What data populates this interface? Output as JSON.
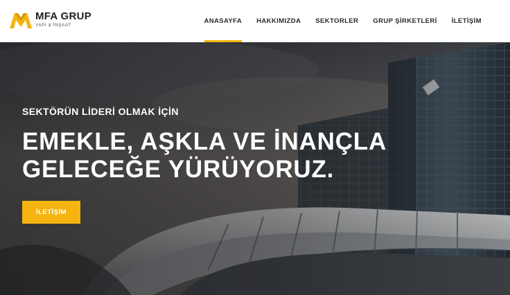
{
  "brand": {
    "name": "MFA GRUP",
    "tagline": "YAPI & İNŞAAT",
    "accent_color": "#f5b40f",
    "logo_icon": "m-shape-icon"
  },
  "nav": {
    "items": [
      {
        "label": "ANASAYFA",
        "active": true
      },
      {
        "label": "HAKKIMIZDA",
        "active": false
      },
      {
        "label": "SEKTORLER",
        "active": false
      },
      {
        "label": "GRUP ŞİRKETLERİ",
        "active": false
      },
      {
        "label": "İLETİŞİM",
        "active": false
      }
    ]
  },
  "hero": {
    "kicker": "SEKTÖRÜN LİDERİ OLMAK İÇİN",
    "title_line1": "EMEKLE, AŞKLA VE İNANÇLA",
    "title_line2": "GELECEĞE YÜRÜYORUZ.",
    "button_label": "İLETİŞİM",
    "button_color": "#f5b40f"
  }
}
